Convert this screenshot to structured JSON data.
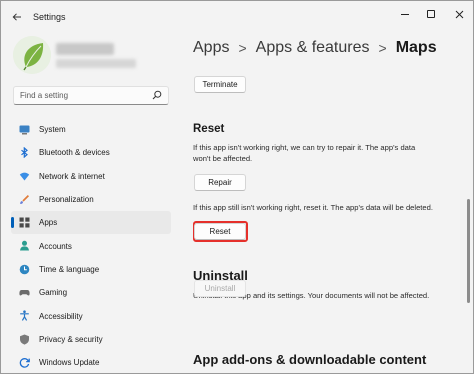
{
  "window": {
    "title": "Settings"
  },
  "sidebar": {
    "search_placeholder": "Find a setting",
    "items": [
      {
        "label": "System",
        "icon": "system-icon"
      },
      {
        "label": "Bluetooth & devices",
        "icon": "bluetooth-icon"
      },
      {
        "label": "Network & internet",
        "icon": "network-icon"
      },
      {
        "label": "Personalization",
        "icon": "personalization-icon"
      },
      {
        "label": "Apps",
        "icon": "apps-icon",
        "selected": true
      },
      {
        "label": "Accounts",
        "icon": "accounts-icon"
      },
      {
        "label": "Time & language",
        "icon": "time-language-icon"
      },
      {
        "label": "Gaming",
        "icon": "gaming-icon"
      },
      {
        "label": "Accessibility",
        "icon": "accessibility-icon"
      },
      {
        "label": "Privacy & security",
        "icon": "privacy-icon"
      },
      {
        "label": "Windows Update",
        "icon": "windows-update-icon"
      }
    ]
  },
  "breadcrumb": {
    "level1": "Apps",
    "level2": "Apps & features",
    "current": "Maps",
    "separator": ">"
  },
  "main": {
    "terminate_label": "Terminate",
    "reset_section": {
      "title": "Reset",
      "repair_text_line1": "If this app isn't working right, we can try to repair it. The app's data",
      "repair_text_line2": "won't be affected.",
      "repair_label": "Repair",
      "reset_text": "If this app still isn't working right, reset it. The app's data will be deleted.",
      "reset_label": "Reset"
    },
    "uninstall_section": {
      "title": "Uninstall",
      "text": "Uninstall this app and its settings. Your documents will not be affected.",
      "uninstall_label": "Uninstall",
      "uninstall_disabled": true
    },
    "addons_title": "App add-ons & downloadable content"
  },
  "colors": {
    "accent": "#005fb8",
    "highlight": "#e5302b",
    "background": "#f3f3f3"
  }
}
